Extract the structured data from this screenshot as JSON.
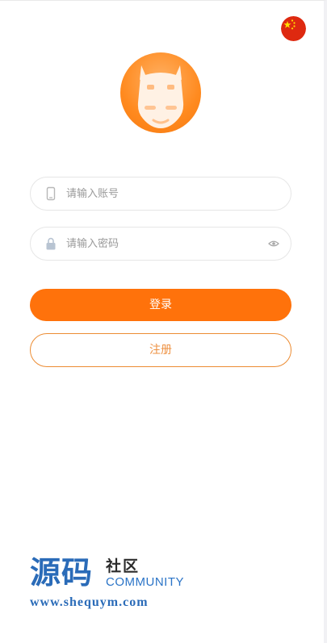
{
  "header": {
    "language_flag_icon": "china-flag-icon"
  },
  "logo": {
    "icon": "cow-face-icon",
    "accent_color": "#ff8a1f"
  },
  "login_form": {
    "account_field": {
      "icon": "phone-icon",
      "placeholder": "请输入账号",
      "value": ""
    },
    "password_field": {
      "icon": "lock-icon",
      "placeholder": "请输入密码",
      "value": "",
      "visibility_toggle_icon": "eye-icon"
    },
    "login_button_label": "登录",
    "register_button_label": "注册"
  },
  "watermark": {
    "brand_big": "源码",
    "brand_small": "社区",
    "brand_en": "COMMUNITY",
    "url": "www.shequym.com"
  },
  "colors": {
    "primary": "#ff720b",
    "register_border": "#ec8c33",
    "register_text": "#ee9142",
    "watermark_blue": "#2a6bb8"
  }
}
